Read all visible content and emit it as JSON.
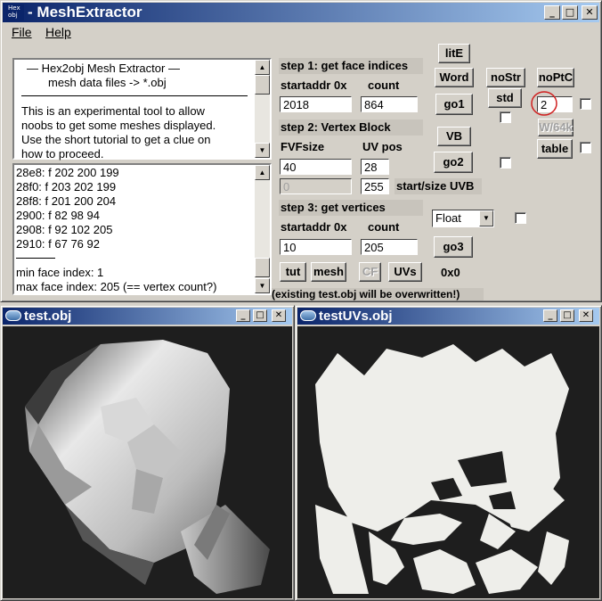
{
  "main_window": {
    "title": "MeshExtractor",
    "title_prefix": "-",
    "app_icon_text": "Hex obj",
    "controls": {
      "minimize": "_",
      "maximize": "□",
      "close": "✕"
    }
  },
  "menu": {
    "file": "File",
    "help": "Help"
  },
  "info_panel": {
    "heading1": "—   Hex2obj Mesh Extractor   —",
    "heading2": "mesh data files -> *.obj",
    "body": [
      "This is an experimental tool to allow",
      "noobs to get some meshes displayed.",
      "Use the short tutorial to get a clue on",
      "how to proceed."
    ]
  },
  "face_list": {
    "lines": [
      "28e8: f  202 200 199",
      "28f0: f  203 202 199",
      "28f8: f  201 200 204",
      "2900: f  82 98 94",
      "2908: f  92 102 205",
      "2910: f  67 76 92"
    ],
    "summary": [
      "min face index: 1",
      "max face index: 205 (== vertex count?)"
    ]
  },
  "step1": {
    "label": "step 1: get face indices",
    "startaddr_label": "startaddr 0x",
    "count_label": "count",
    "startaddr": "2018",
    "count": "864"
  },
  "step2": {
    "label": "step 2: Vertex Block",
    "fvf_label": "FVFsize",
    "uv_label": "UV pos",
    "fvf": "40",
    "uvpos": "28",
    "uvb_start": "0",
    "uvb_size": "255",
    "uvb_label": "start/size UVB"
  },
  "step3": {
    "label": "step 3: get vertices",
    "startaddr_label": "startaddr 0x",
    "count_label": "count",
    "startaddr": "10",
    "count": "205",
    "format": "Float"
  },
  "buttons": {
    "lite": "litE",
    "word": "Word",
    "go1": "go1",
    "vb": "VB",
    "go2": "go2",
    "go3": "go3",
    "nostr": "noStr",
    "std": "std",
    "noptc": "noPtC",
    "w64k": "W/64k",
    "table": "table",
    "tut": "tut",
    "mesh": "mesh",
    "cf": "CF",
    "uvs": "UVs"
  },
  "field_2": "2",
  "zero_x_zero": "0x0",
  "status": "(existing test.obj will be overwritten!)",
  "test_window": {
    "title": "test.obj"
  },
  "uv_window": {
    "title": "testUVs.obj"
  },
  "colors": {
    "title_start": "#0a246a",
    "title_end": "#a6caf0",
    "face_bg": "#d4d0c8",
    "viewport_bg": "#1e1e1e",
    "uv_fill": "#eeeeea",
    "annotation_circle": "#d02020"
  }
}
